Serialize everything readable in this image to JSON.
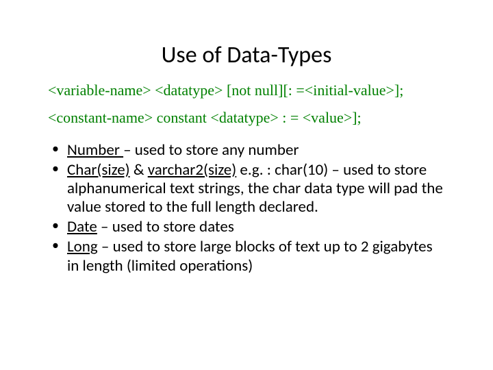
{
  "title": "Use of Data-Types",
  "syntax1": "<variable-name> <datatype> [not null][: =<initial-value>];",
  "syntax2": "<constant-name> constant <datatype> : = <value>];",
  "bullets": {
    "b1": {
      "term": "Number ",
      "rest": "– used to store any number"
    },
    "b2": {
      "term1": "Char(size)",
      "amp": " & ",
      "term2": "varchar2(size)",
      "rest": " e.g. : char(10) – used to store alphanumerical text strings, the char data type will pad the value stored to the full length declared."
    },
    "b3": {
      "term": "Date",
      "rest": " – used to store dates"
    },
    "b4": {
      "term": "Long",
      "rest": " – used to store large blocks of text up to 2 gigabytes in length (limited operations)"
    }
  }
}
